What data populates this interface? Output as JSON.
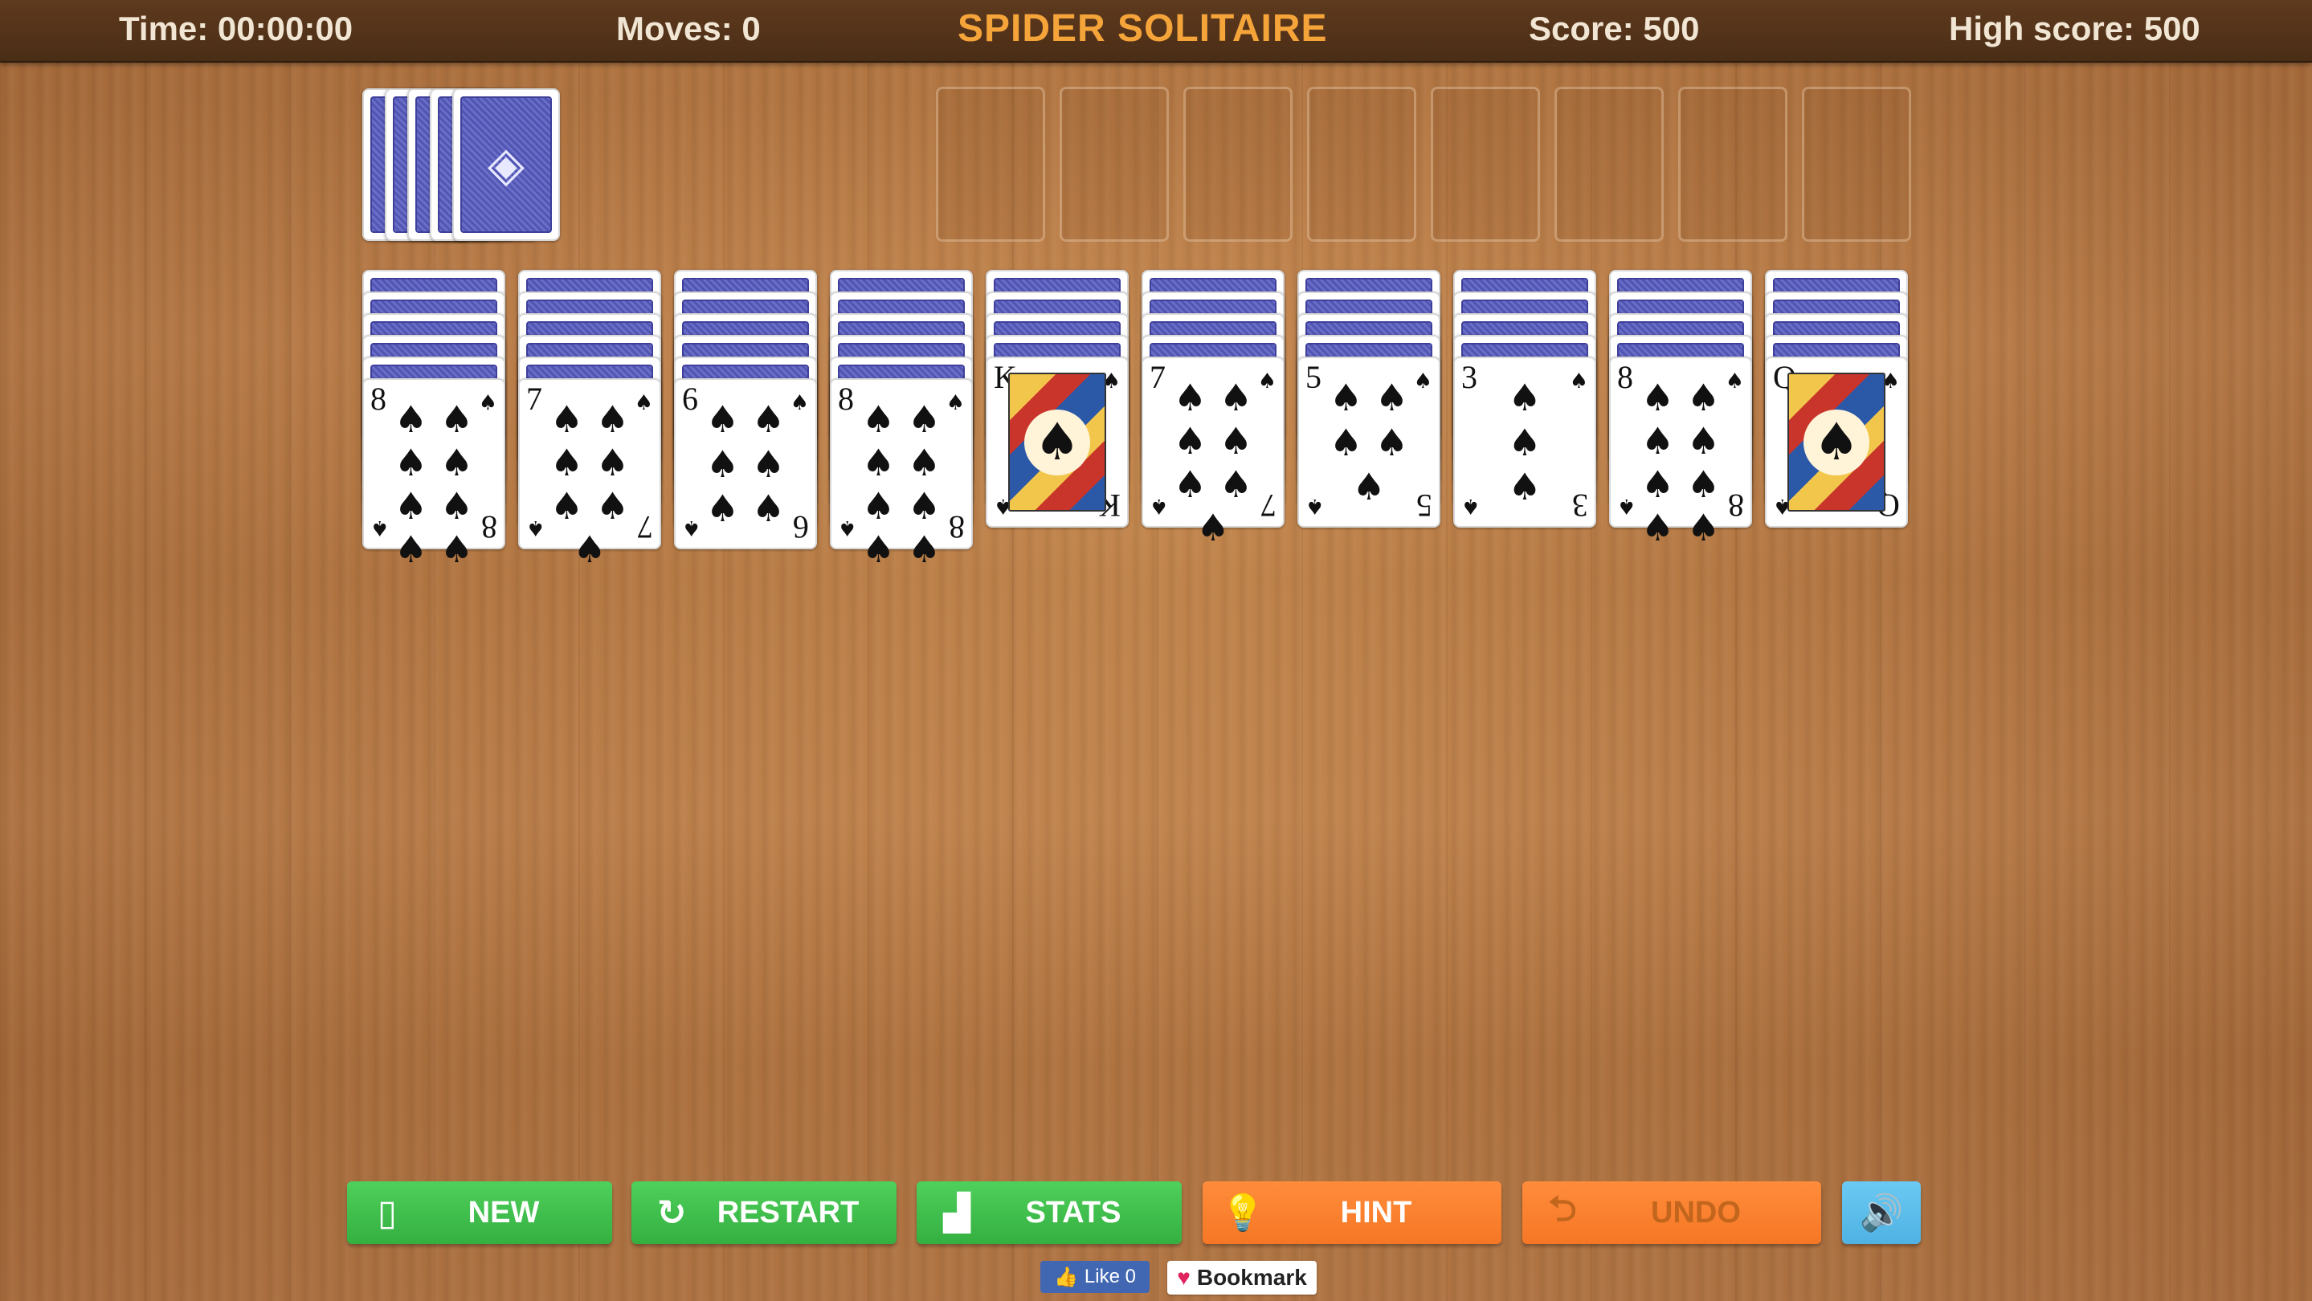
{
  "header": {
    "time": "Time: 00:00:00",
    "moves": "Moves: 0",
    "title": "SPIDER SOLITAIRE",
    "score": "Score: 500",
    "high_score": "High score: 500"
  },
  "stock": {
    "piles": 5
  },
  "foundations": {
    "count": 8
  },
  "tableau": [
    {
      "face_down": 5,
      "rank": "8",
      "suit": "♠"
    },
    {
      "face_down": 5,
      "rank": "7",
      "suit": "♠"
    },
    {
      "face_down": 5,
      "rank": "6",
      "suit": "♠"
    },
    {
      "face_down": 5,
      "rank": "8",
      "suit": "♠"
    },
    {
      "face_down": 4,
      "rank": "K",
      "suit": "♠"
    },
    {
      "face_down": 4,
      "rank": "7",
      "suit": "♠"
    },
    {
      "face_down": 4,
      "rank": "5",
      "suit": "♠"
    },
    {
      "face_down": 4,
      "rank": "3",
      "suit": "♠"
    },
    {
      "face_down": 4,
      "rank": "8",
      "suit": "♠"
    },
    {
      "face_down": 4,
      "rank": "Q",
      "suit": "♠"
    }
  ],
  "buttons": {
    "new": "NEW",
    "restart": "RESTART",
    "stats": "STATS",
    "hint": "HINT",
    "undo": "UNDO"
  },
  "social": {
    "like": "Like 0",
    "bookmark": "Bookmark"
  },
  "icons": {
    "new": "card-icon",
    "restart": "restart-icon",
    "stats": "bar-chart-icon",
    "hint": "lightbulb-icon",
    "undo": "undo-arrow-icon",
    "sound": "speaker-icon",
    "like": "thumbs-up-icon",
    "bookmark": "heart-icon"
  },
  "colors": {
    "green_button": "#3fbf4c",
    "orange_button": "#f77f2c",
    "sound_button": "#5cbbe9",
    "title": "#f5a43a",
    "card_back": "#5a5eb9"
  }
}
